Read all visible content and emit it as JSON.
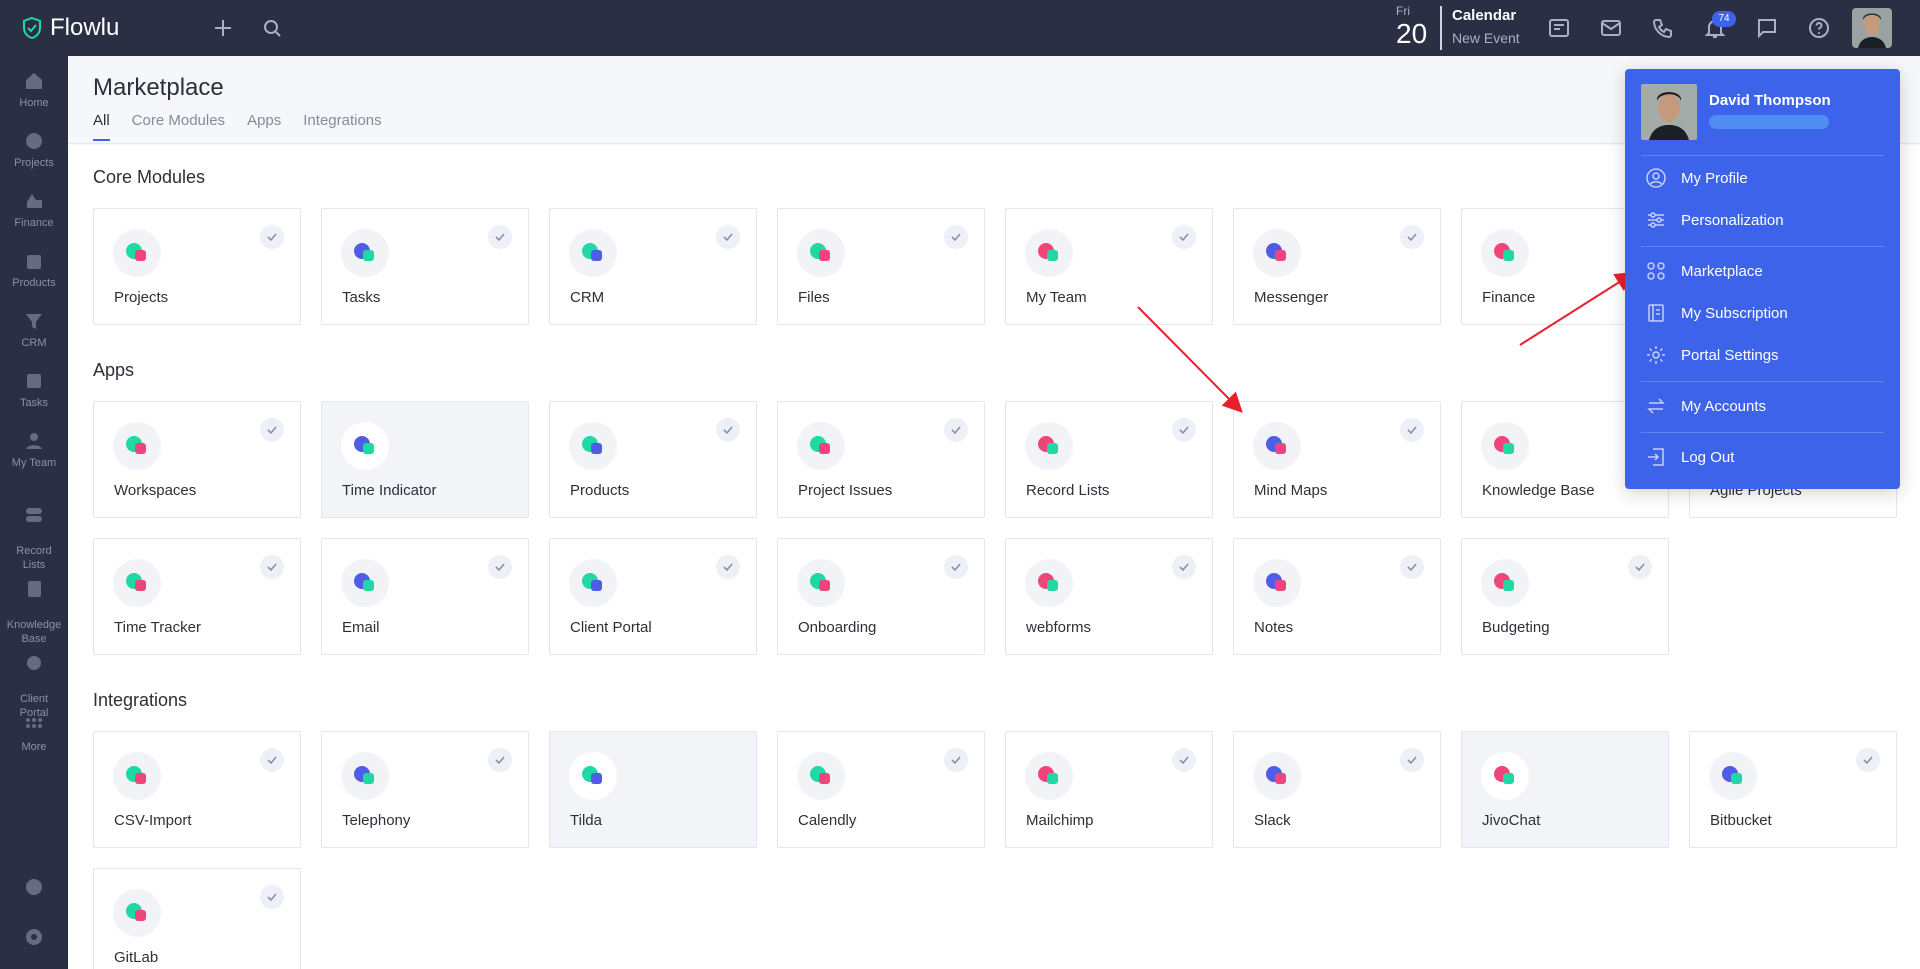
{
  "app": {
    "name": "Flowlu"
  },
  "topbar": {
    "date_day": "Fri",
    "date_num": "20",
    "calendar_title": "Calendar",
    "calendar_sub": "New Event",
    "notification_count": "74"
  },
  "sidebar": {
    "items": [
      {
        "label": "Home",
        "icon": "home-icon"
      },
      {
        "label": "Projects",
        "icon": "projects-icon"
      },
      {
        "label": "Finance",
        "icon": "finance-icon"
      },
      {
        "label": "Products",
        "icon": "products-icon"
      },
      {
        "label": "CRM",
        "icon": "crm-icon"
      },
      {
        "label": "Tasks",
        "icon": "tasks-icon"
      },
      {
        "label": "My Team",
        "icon": "team-icon"
      },
      {
        "label": "Record\nLists",
        "icon": "record-lists-icon"
      },
      {
        "label": "Knowledge\nBase",
        "icon": "knowledge-base-icon"
      },
      {
        "label": "Client\nPortal",
        "icon": "client-portal-icon"
      },
      {
        "label": "More",
        "icon": "more-icon"
      }
    ]
  },
  "page": {
    "title": "Marketplace",
    "tabs": [
      "All",
      "Core Modules",
      "Apps",
      "Integrations"
    ],
    "active_tab": "All"
  },
  "sections": {
    "core_title": "Core Modules",
    "apps_title": "Apps",
    "integrations_title": "Integrations"
  },
  "core_modules": [
    "Projects",
    "Tasks",
    "CRM",
    "Files",
    "My Team",
    "Messenger",
    "Finance"
  ],
  "apps_row1": [
    "Workspaces",
    "Time Indicator",
    "Products",
    "Project Issues",
    "Record Lists",
    "Mind Maps",
    "Knowledge Base",
    "Agile Projects"
  ],
  "apps_row2": [
    "Time Tracker",
    "Email",
    "Client Portal",
    "Onboarding",
    "webforms",
    "Notes",
    "Budgeting"
  ],
  "integrations_row1": [
    "CSV-Import",
    "Telephony",
    "Tilda",
    "Calendly",
    "Mailchimp",
    "Slack",
    "JivoChat",
    "Bitbucket"
  ],
  "integrations_row2": [
    "GitLab"
  ],
  "dropdown": {
    "user_name": "David Thompson",
    "items": [
      "My Profile",
      "Personalization",
      "Marketplace",
      "My Subscription",
      "Portal Settings",
      "My Accounts",
      "Log Out"
    ]
  },
  "colors": {
    "topbar": "#2b2f44",
    "accent": "#3d63ea",
    "icon_teal": "#1ed9a4",
    "icon_pink": "#f0457a",
    "icon_blue": "#4f5de6",
    "arrow": "#e8202a"
  }
}
